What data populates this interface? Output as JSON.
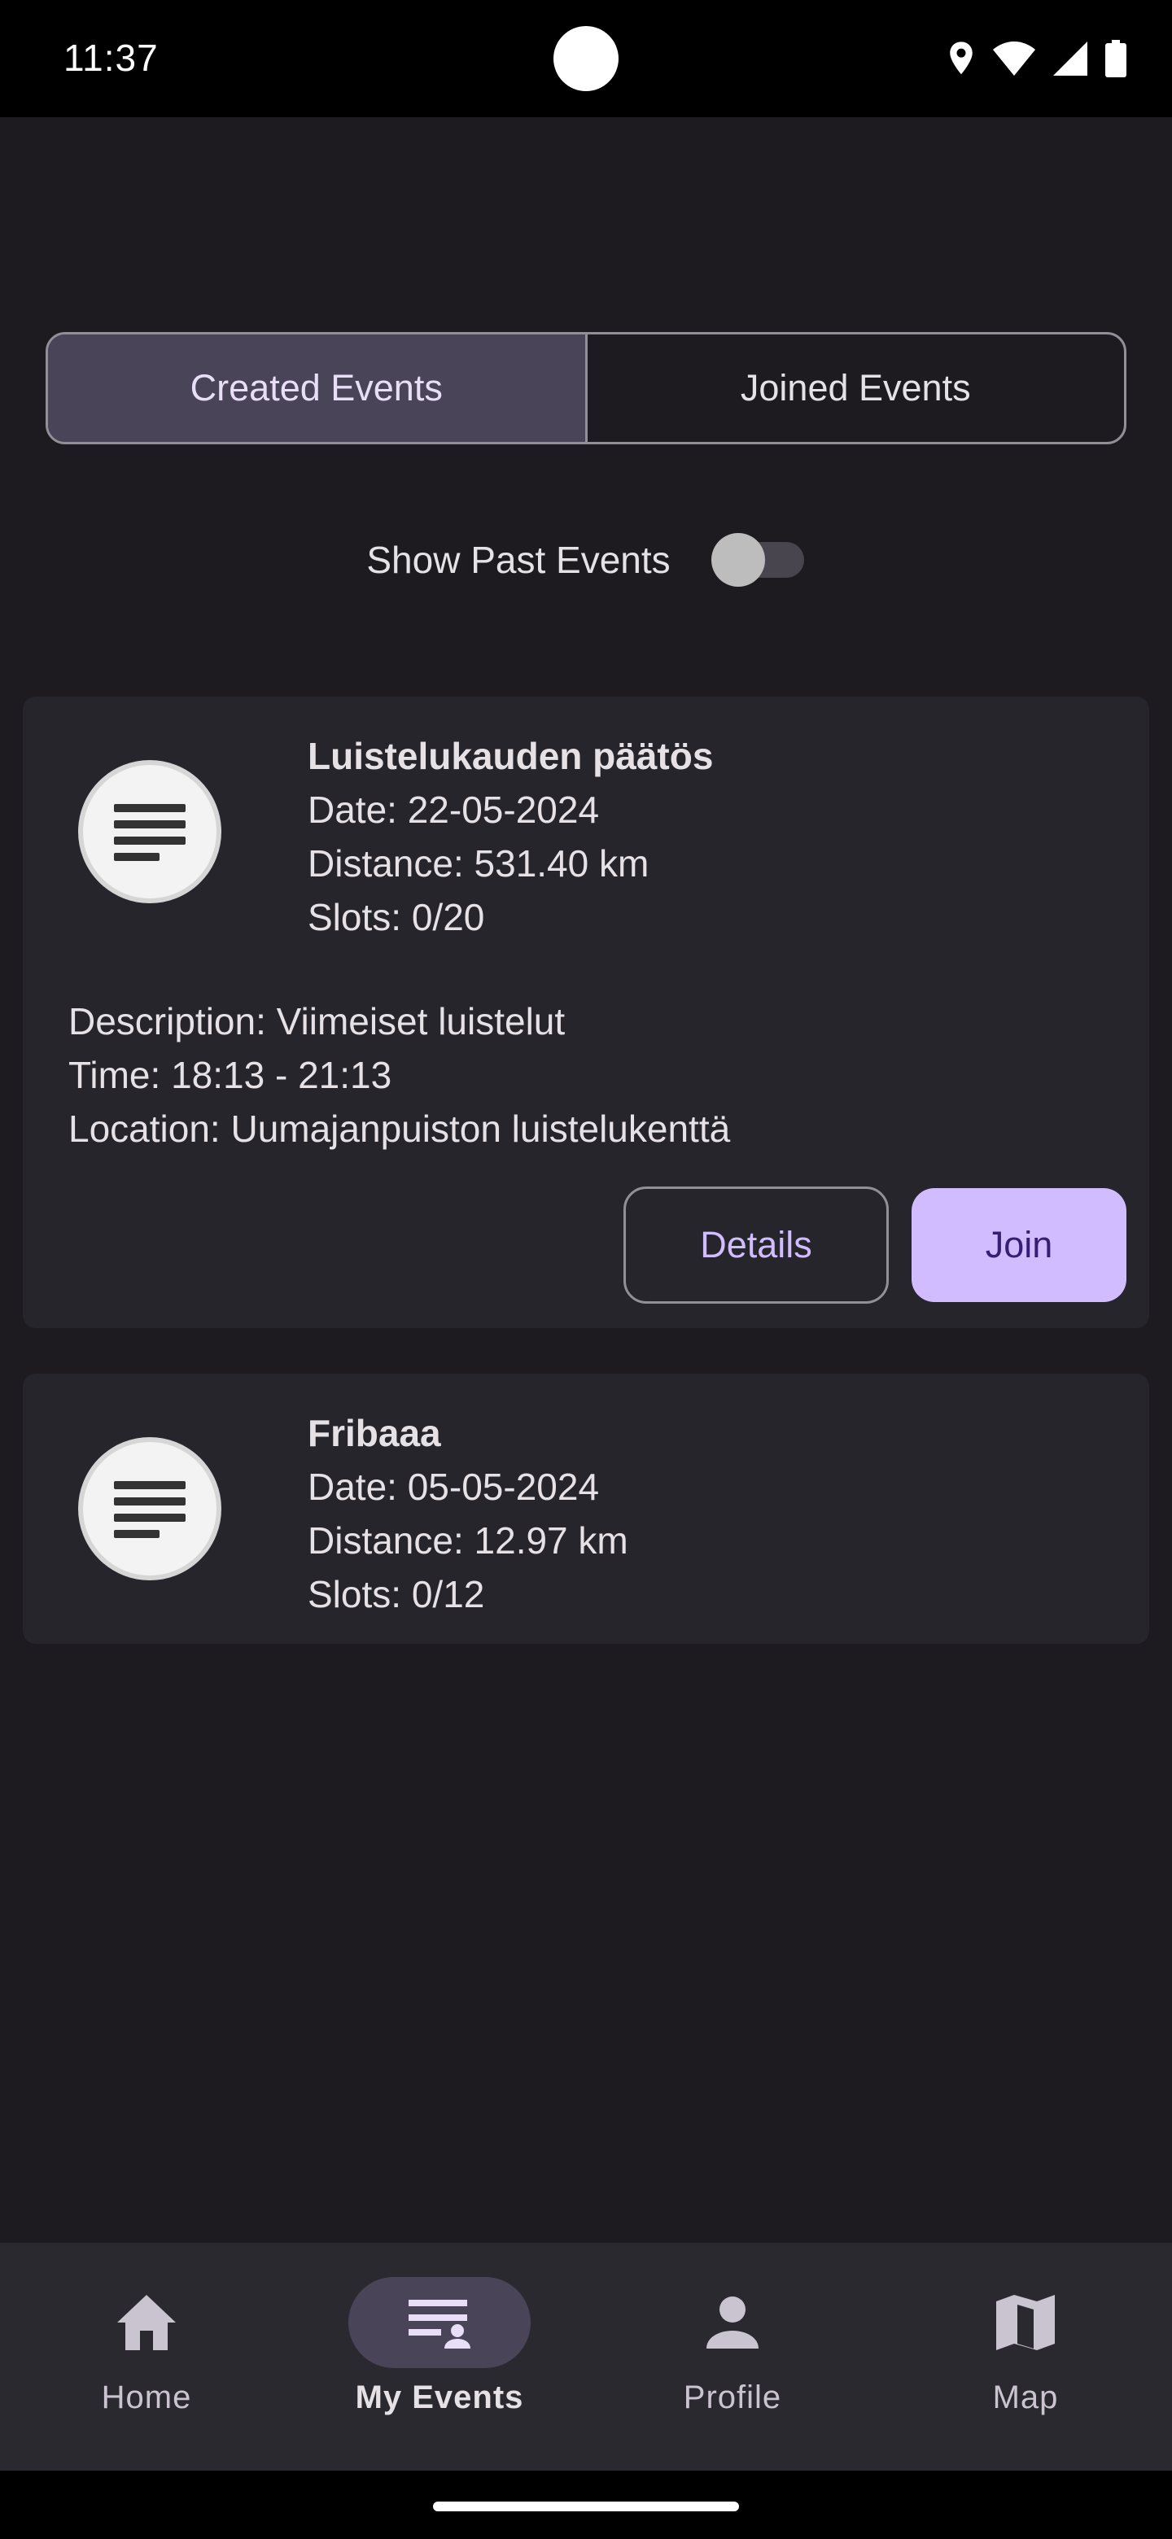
{
  "status_bar": {
    "time": "11:37",
    "icons": [
      "location-icon",
      "wifi-icon",
      "signal-icon",
      "battery-icon"
    ]
  },
  "tabs": [
    {
      "label": "Created Events",
      "active": true
    },
    {
      "label": "Joined Events",
      "active": false
    }
  ],
  "past_toggle": {
    "label": "Show Past Events",
    "on": false
  },
  "events": [
    {
      "title": "Luistelukauden päätös",
      "date": "Date: 22-05-2024",
      "distance": "Distance: 531.40 km",
      "slots": "Slots: 0/20",
      "description": "Description: Viimeiset luistelut",
      "time": "Time: 18:13 - 21:13",
      "location": "Location: Uumajanpuiston luistelukenttä",
      "details_label": "Details",
      "join_label": "Join",
      "icon": "notes-icon"
    },
    {
      "title": "Fribaaa",
      "date": "Date: 05-05-2024",
      "distance": "Distance: 12.97 km",
      "slots": "Slots: 0/12",
      "icon": "notes-icon"
    }
  ],
  "bottom_nav": [
    {
      "label": "Home",
      "icon": "home-icon",
      "active": false
    },
    {
      "label": "My Events",
      "icon": "my-events-icon",
      "active": true
    },
    {
      "label": "Profile",
      "icon": "person-icon",
      "active": false
    },
    {
      "label": "Map",
      "icon": "map-icon",
      "active": false
    }
  ],
  "colors": {
    "background": "#1d1b20",
    "card": "#26252c",
    "accent": "#d0bcff",
    "active_tab": "#4a4458",
    "nav_bar": "#2b2930"
  }
}
